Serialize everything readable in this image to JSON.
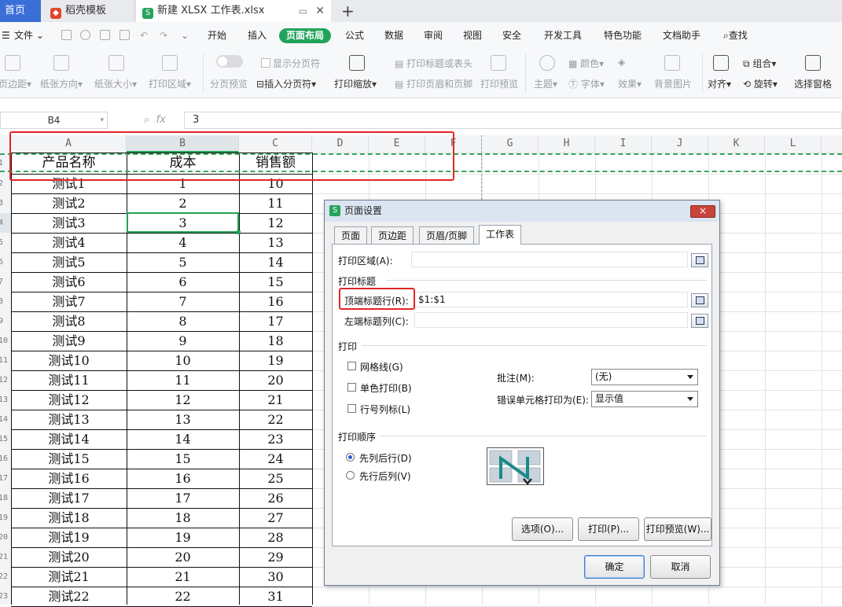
{
  "tabs": {
    "home": "首页",
    "template": "稻壳模板",
    "file": "新建 XLSX 工作表.xlsx"
  },
  "menubar": {
    "file_menu": "文件",
    "items": [
      "开始",
      "插入",
      "页面布局",
      "公式",
      "数据",
      "审阅",
      "视图",
      "安全",
      "开发工具",
      "特色功能",
      "文档助手"
    ],
    "active": "页面布局",
    "search": "查找"
  },
  "ribbon": {
    "margins": "页边距",
    "orientation": "纸张方向",
    "size": "纸张大小",
    "print_area": "打印区域",
    "page_break_preview": "分页预览",
    "show_page_breaks": "显示分页符",
    "insert_page_break": "插入分页符",
    "print_scaling": "打印缩放",
    "print_titles": "打印标题或表头",
    "print_header_footer": "打印页眉和页脚",
    "print_preview": "打印预览",
    "theme": "主题",
    "colors": "颜色",
    "fonts": "字体",
    "effects": "效果",
    "background": "背景图片",
    "align": "对齐",
    "group": "组合",
    "rotate": "旋转",
    "selection_pane": "选择窗格"
  },
  "formula_bar": {
    "name_box": "B4",
    "fx": "fx",
    "value": "3"
  },
  "sheet": {
    "columns": [
      "A",
      "B",
      "C",
      "D",
      "E",
      "F",
      "G",
      "H",
      "I",
      "J",
      "K",
      "L"
    ],
    "row_numbers": [
      "1",
      "2",
      "3",
      "4",
      "5",
      "6",
      "7",
      "8",
      "9",
      "10",
      "11",
      "12",
      "13",
      "14",
      "15",
      "16",
      "17",
      "18",
      "19",
      "20",
      "21",
      "22",
      "23"
    ],
    "header": [
      "产品名称",
      "成本",
      "销售额"
    ],
    "rows": [
      [
        "测试1",
        "1",
        "10"
      ],
      [
        "测试2",
        "2",
        "11"
      ],
      [
        "测试3",
        "3",
        "12"
      ],
      [
        "测试4",
        "4",
        "13"
      ],
      [
        "测试5",
        "5",
        "14"
      ],
      [
        "测试6",
        "6",
        "15"
      ],
      [
        "测试7",
        "7",
        "16"
      ],
      [
        "测试8",
        "8",
        "17"
      ],
      [
        "测试9",
        "9",
        "18"
      ],
      [
        "测试10",
        "10",
        "19"
      ],
      [
        "测试11",
        "11",
        "20"
      ],
      [
        "测试12",
        "12",
        "21"
      ],
      [
        "测试13",
        "13",
        "22"
      ],
      [
        "测试14",
        "14",
        "23"
      ],
      [
        "测试15",
        "15",
        "24"
      ],
      [
        "测试16",
        "16",
        "25"
      ],
      [
        "测试17",
        "17",
        "26"
      ],
      [
        "测试18",
        "18",
        "27"
      ],
      [
        "测试19",
        "19",
        "28"
      ],
      [
        "测试20",
        "20",
        "29"
      ],
      [
        "测试21",
        "21",
        "30"
      ],
      [
        "测试22",
        "22",
        "31"
      ]
    ]
  },
  "dialog": {
    "title": "页面设置",
    "close": "×",
    "tabs": [
      "页面",
      "页边距",
      "页眉/页脚",
      "工作表"
    ],
    "print_area_label": "打印区域(A):",
    "print_area_value": "",
    "print_titles_section": "打印标题",
    "rows_to_repeat_label": "顶端标题行(R):",
    "rows_to_repeat_value": "$1:$1",
    "cols_to_repeat_label": "左端标题列(C):",
    "cols_to_repeat_value": "",
    "print_section": "打印",
    "gridlines": "网格线(G)",
    "black_white": "单色打印(B)",
    "row_col_headings": "行号列标(L)",
    "comments_label": "批注(M):",
    "comments_value": "(无)",
    "cell_errors_label": "错误单元格打印为(E):",
    "cell_errors_value": "显示值",
    "page_order_section": "打印顺序",
    "down_then_over": "先列后行(D)",
    "over_then_down": "先行后列(V)",
    "options_button": "选项(O)...",
    "print_button": "打印(P)...",
    "preview_button": "打印预览(W)...",
    "ok_button": "确定",
    "cancel_button": "取消"
  },
  "colors": {
    "accent_green": "#22a35a",
    "highlight_red": "#e0262a",
    "tab_blue": "#3b6fd8"
  }
}
